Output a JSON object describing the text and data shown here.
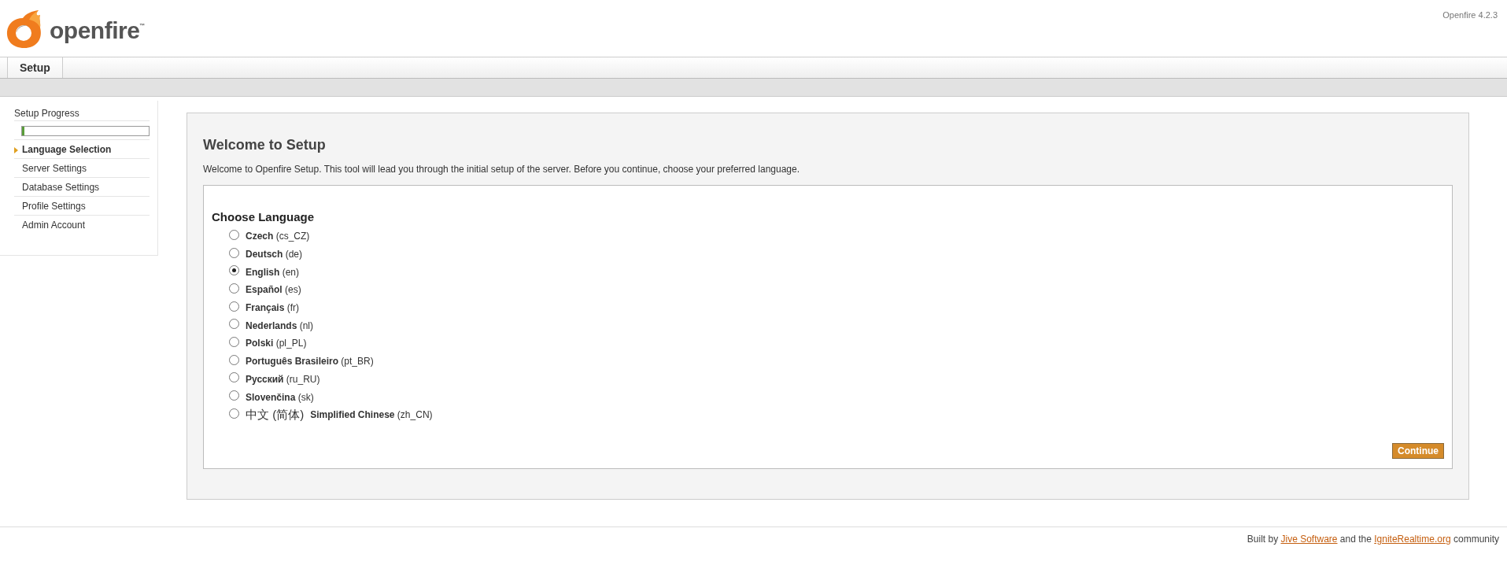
{
  "header": {
    "logo_text": "openfire",
    "logo_mark": "™",
    "version": "Openfire 4.2.3"
  },
  "tabs": [
    {
      "label": "Setup",
      "selected": true
    }
  ],
  "sidebar": {
    "title": "Setup Progress",
    "level": 0.02,
    "items": [
      {
        "label": "Language Selection",
        "selected": true
      },
      {
        "label": "Server Settings",
        "selected": false
      },
      {
        "label": "Database Settings",
        "selected": false
      },
      {
        "label": "Profile Settings",
        "selected": false
      },
      {
        "label": "Admin Account",
        "selected": false
      }
    ]
  },
  "main": {
    "title": "Welcome to Setup",
    "intro": "Welcome to Openfire Setup. This tool will lead you through the initial setup of the server. Before you continue, choose your preferred language.",
    "section_title": "Choose Language",
    "languages": [
      {
        "name": "Czech",
        "code": "(cs_CZ)",
        "selected": false
      },
      {
        "name": "Deutsch",
        "code": "(de)",
        "selected": false
      },
      {
        "name": "English",
        "code": "(en)",
        "selected": true
      },
      {
        "name": "Español",
        "code": "(es)",
        "selected": false
      },
      {
        "name": "Français",
        "code": "(fr)",
        "selected": false
      },
      {
        "name": "Nederlands",
        "code": "(nl)",
        "selected": false
      },
      {
        "name": "Polski",
        "code": "(pl_PL)",
        "selected": false
      },
      {
        "name": "Português Brasileiro",
        "code": "(pt_BR)",
        "selected": false
      },
      {
        "name": "Русский",
        "code": "(ru_RU)",
        "selected": false
      },
      {
        "name": "Slovenčina",
        "code": "(sk)",
        "selected": false
      },
      {
        "native": "中文 (简体)",
        "name": "Simplified Chinese",
        "code": "(zh_CN)",
        "selected": false
      }
    ],
    "button": "Continue"
  },
  "footer": {
    "before": "Built by",
    "link_1": "Jive Software",
    "middle": "and the",
    "link_2": "IgniteRealtime.org",
    "after": "community"
  }
}
